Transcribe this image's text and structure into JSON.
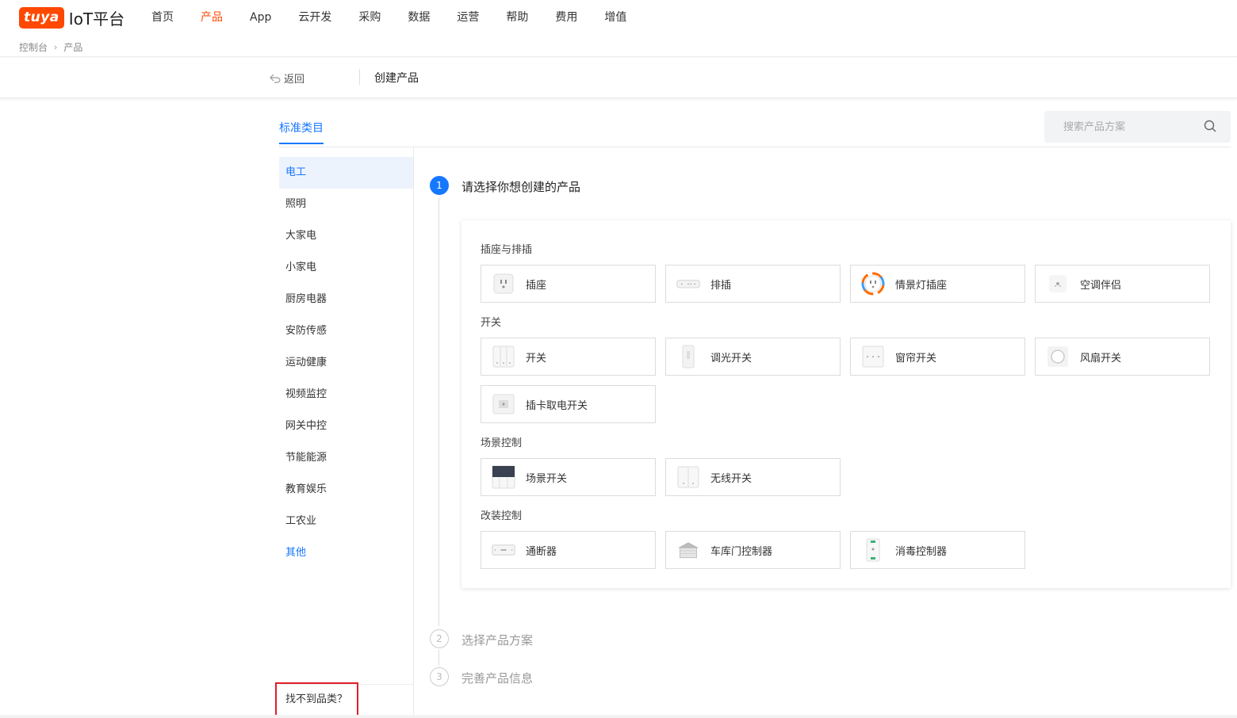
{
  "brand": {
    "badge": "tuya",
    "name": "IoT平台",
    "color": "#ff4800"
  },
  "nav": {
    "items": [
      "首页",
      "产品",
      "App",
      "云开发",
      "采购",
      "数据",
      "运营",
      "帮助",
      "费用",
      "增值"
    ],
    "active_index": 1
  },
  "breadcrumb": {
    "items": [
      "控制台",
      "产品"
    ]
  },
  "subheader": {
    "back_label": "返回",
    "title": "创建产品"
  },
  "tabs": {
    "standard": "标准类目"
  },
  "search": {
    "placeholder": "搜索产品方案"
  },
  "sidebar": {
    "categories": [
      "电工",
      "照明",
      "大家电",
      "小家电",
      "厨房电器",
      "安防传感",
      "运动健康",
      "视频监控",
      "网关中控",
      "节能能源",
      "教育娱乐",
      "工农业",
      "其他"
    ],
    "active_index": 0,
    "not_found_label": "找不到品类？"
  },
  "steps": [
    {
      "num": "1",
      "title": "请选择你想创建的产品",
      "state": "active"
    },
    {
      "num": "2",
      "title": "选择产品方案",
      "state": "pending"
    },
    {
      "num": "3",
      "title": "完善产品信息",
      "state": "pending"
    }
  ],
  "groups": [
    {
      "label": "插座与排插",
      "items": [
        {
          "label": "插座",
          "icon": "socket-icon"
        },
        {
          "label": "排插",
          "icon": "power-strip-icon"
        },
        {
          "label": "情景灯插座",
          "icon": "rgb-socket-icon"
        },
        {
          "label": "空调伴侣",
          "icon": "ac-companion-icon"
        }
      ]
    },
    {
      "label": "开关",
      "items": [
        {
          "label": "开关",
          "icon": "switch-icon"
        },
        {
          "label": "调光开关",
          "icon": "dimmer-switch-icon"
        },
        {
          "label": "窗帘开关",
          "icon": "curtain-switch-icon"
        },
        {
          "label": "风扇开关",
          "icon": "fan-switch-icon"
        },
        {
          "label": "插卡取电开关",
          "icon": "card-switch-icon"
        }
      ]
    },
    {
      "label": "场景控制",
      "items": [
        {
          "label": "场景开关",
          "icon": "scene-switch-icon"
        },
        {
          "label": "无线开关",
          "icon": "wireless-switch-icon"
        }
      ]
    },
    {
      "label": "改装控制",
      "items": [
        {
          "label": "通断器",
          "icon": "breaker-icon"
        },
        {
          "label": "车库门控制器",
          "icon": "garage-door-icon"
        },
        {
          "label": "消毒控制器",
          "icon": "disinfection-icon"
        }
      ]
    }
  ],
  "colors": {
    "accent": "#1677ff",
    "brand": "#ff4800",
    "highlight_border": "#e0202a"
  }
}
